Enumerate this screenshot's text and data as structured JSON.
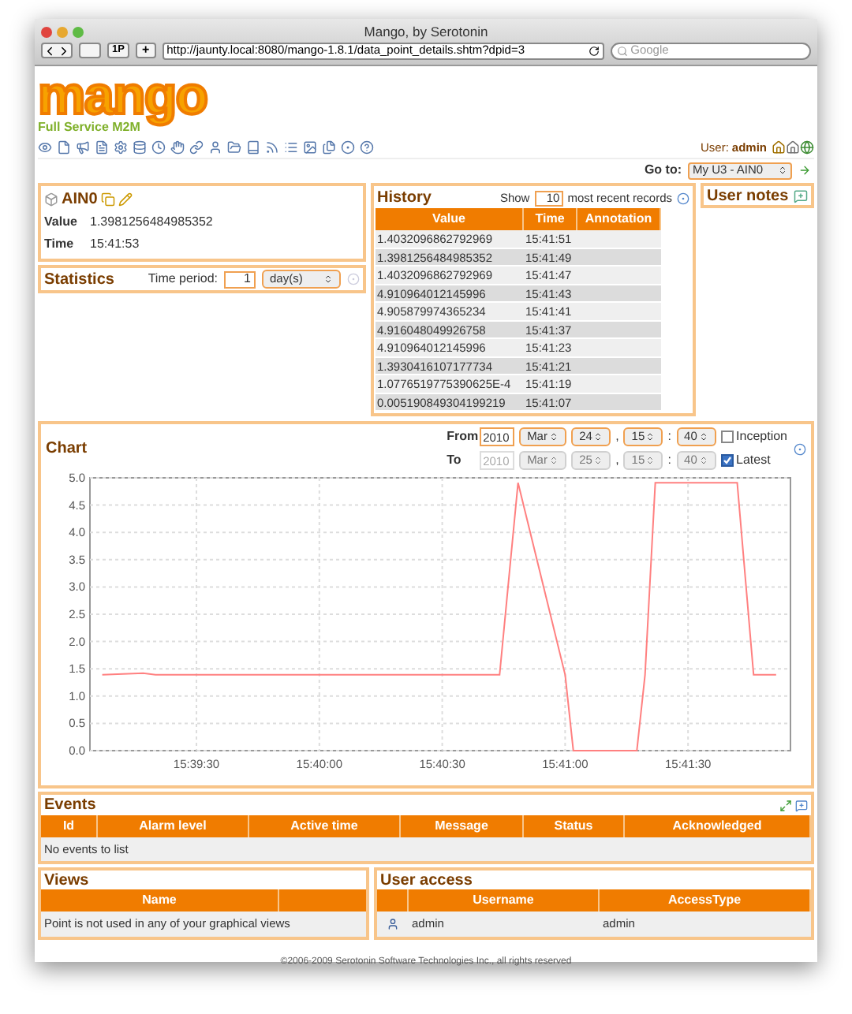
{
  "browser": {
    "title": "Mango, by Serotonin",
    "url": "http://jaunty.local:8080/mango-1.8.1/data_point_details.shtm?dpid=3",
    "search_placeholder": "Google",
    "button_1p": "1P",
    "button_add": "+"
  },
  "header": {
    "logo": "mango",
    "tagline": "Full Service M2M",
    "user_label": "User:",
    "user": "admin"
  },
  "goto": {
    "label": "Go to:",
    "value": "My U3 - AIN0"
  },
  "point": {
    "name": "AIN0",
    "value_label": "Value",
    "value": "1.3981256484985352",
    "time_label": "Time",
    "time": "15:41:53"
  },
  "statistics": {
    "title": "Statistics",
    "period_label": "Time period:",
    "period_value": "1",
    "period_unit": "day(s)"
  },
  "history": {
    "title": "History",
    "show_label": "Show",
    "count": "10",
    "suffix": "most recent records",
    "columns": [
      "Value",
      "Time",
      "Annotation"
    ],
    "rows": [
      [
        "1.4032096862792969",
        "15:41:51"
      ],
      [
        "1.3981256484985352",
        "15:41:49"
      ],
      [
        "1.4032096862792969",
        "15:41:47"
      ],
      [
        "4.910964012145996",
        "15:41:43"
      ],
      [
        "4.905879974365234",
        "15:41:41"
      ],
      [
        "4.916048049926758",
        "15:41:37"
      ],
      [
        "4.910964012145996",
        "15:41:23"
      ],
      [
        "1.3930416107177734",
        "15:41:21"
      ],
      [
        "1.0776519775390625E-4",
        "15:41:19"
      ],
      [
        "0.005190849304199219",
        "15:41:07"
      ]
    ]
  },
  "user_notes": {
    "title": "User notes"
  },
  "chart": {
    "title": "Chart",
    "from_label": "From",
    "to_label": "To",
    "from_separators": [
      ",",
      ":"
    ],
    "to_separators": [
      ",",
      ":"
    ],
    "from": {
      "disabled": false,
      "year": "2010",
      "month": "Mar",
      "day": "24",
      "hour": "15",
      "minute": "40"
    },
    "to": {
      "disabled": true,
      "year": "2010",
      "month": "Mar",
      "day": "25",
      "hour": "15",
      "minute": "40"
    },
    "inception": {
      "label": "Inception",
      "checked": false
    },
    "latest": {
      "label": "Latest",
      "checked": true
    },
    "chart_data": {
      "type": "line",
      "x": [
        56347,
        56357,
        56360,
        56444,
        56448.5,
        56460,
        56462,
        56477.5,
        56479.5,
        56482,
        56502,
        56506,
        56511.5
      ],
      "series": [
        {
          "color": "#ff8080",
          "values": [
            1.39,
            1.42,
            1.39,
            1.39,
            4.91,
            1.39,
            0,
            0,
            1.39,
            4.91,
            4.91,
            1.39,
            1.39
          ]
        }
      ],
      "grid": true,
      "xlim": [
        56344,
        56515
      ],
      "ylim": [
        0,
        5
      ],
      "xticks": [
        {
          "value": 56370,
          "label": "15:39:30"
        },
        {
          "value": 56400,
          "label": "15:40:00"
        },
        {
          "value": 56430,
          "label": "15:40:30"
        },
        {
          "value": 56460,
          "label": "15:41:00"
        },
        {
          "value": 56490,
          "label": "15:41:30"
        }
      ],
      "yticks": [
        {
          "value": 0,
          "label": "0.0"
        },
        {
          "value": 0.5,
          "label": "0.5"
        },
        {
          "value": 1,
          "label": "1.0"
        },
        {
          "value": 1.5,
          "label": "1.5"
        },
        {
          "value": 2,
          "label": "2.0"
        },
        {
          "value": 2.5,
          "label": "2.5"
        },
        {
          "value": 3,
          "label": "3.0"
        },
        {
          "value": 3.5,
          "label": "3.5"
        },
        {
          "value": 4,
          "label": "4.0"
        },
        {
          "value": 4.5,
          "label": "4.5"
        },
        {
          "value": 5,
          "label": "5.0"
        }
      ]
    }
  },
  "events": {
    "title": "Events",
    "columns": [
      "Id",
      "Alarm level",
      "Active time",
      "Message",
      "Status",
      "Acknowledged"
    ],
    "empty": "No events to list"
  },
  "views": {
    "title": "Views",
    "columns": [
      "Name"
    ],
    "empty": "Point is not used in any of your graphical views"
  },
  "user_access": {
    "title": "User access",
    "columns": [
      "Username",
      "AccessType"
    ],
    "rows": [
      {
        "username": "admin",
        "access": "admin"
      }
    ]
  },
  "footer": "©2006-2009 Serotonin Software Technologies Inc., all rights reserved"
}
